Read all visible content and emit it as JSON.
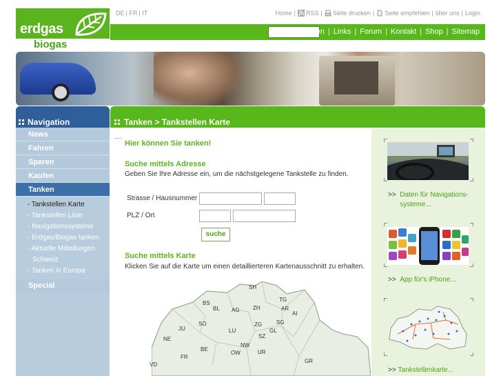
{
  "logo": {
    "line1": "erdgas",
    "line2": "biogas"
  },
  "languages": [
    "DE",
    "FR",
    "IT"
  ],
  "top_links": [
    "Home",
    "RSS",
    "Seite drucken",
    "Seite empfehlen",
    "über uns",
    "Login"
  ],
  "main_nav": [
    "Suchen",
    "Links",
    "Forum",
    "Kontakt",
    "Shop",
    "Sitemap"
  ],
  "sidebar": {
    "title": "Navigation",
    "items": [
      "News",
      "Fahren",
      "Sparen",
      "Kaufen",
      "Tanken"
    ],
    "subitems": [
      "- Tankstellen Karte",
      "- Tankstellen Liste",
      "- Navigationssysteme",
      "- Erdgas/Biogas tanken",
      "- Aktuelle Mitteilungen",
      "Schweiz",
      "- Tanken in Europa"
    ],
    "last_item": "Special"
  },
  "breadcrumb": "Tanken > Tankstellen Karte",
  "content": {
    "ellipsis": "....",
    "heading": "Hier können Sie tanken!",
    "address_heading": "Suche mittels Adresse",
    "address_text": "Geben Sie Ihre Adresse ein, um die nächstgelegene Tankstelle zu finden.",
    "street_label": "Strasse / Hausnummer",
    "zip_label": "PLZ / Ort",
    "search_button": "suche",
    "map_heading": "Suche mittels Karte",
    "map_text": "Klicken Sie auf die Karte um einen detaillierteren Kartenausschnitt zu erhalten."
  },
  "map_labels": [
    "SH",
    "BS",
    "BL",
    "TG",
    "AG",
    "ZH",
    "AR",
    "AI",
    "SG",
    "SO",
    "ZG",
    "SZ",
    "LU",
    "GL",
    "NE",
    "NW",
    "JU",
    "FR",
    "BE",
    "OW",
    "UR",
    "VD",
    "GR"
  ],
  "right_col": {
    "prefix": ">>",
    "link1": "Daten für Navigations-systeme...",
    "link2": "App für's iPhone...",
    "link3": "Tankstellenkarte..."
  }
}
